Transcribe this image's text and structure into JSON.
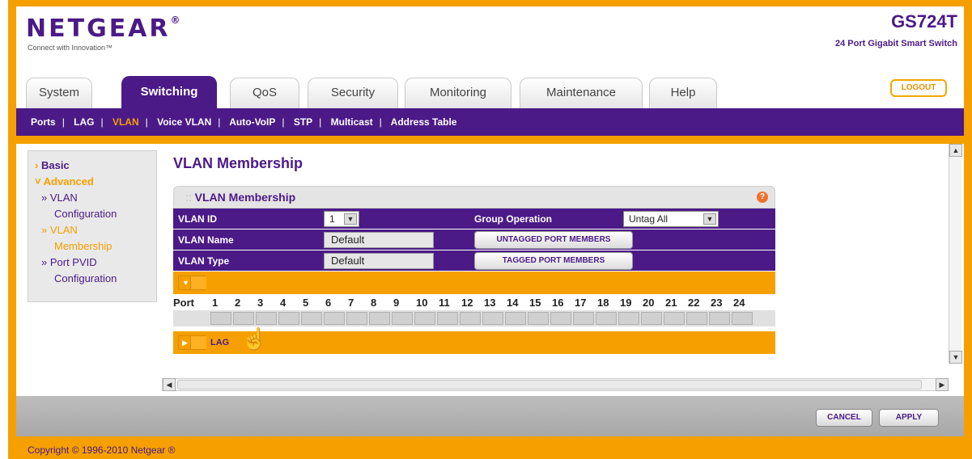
{
  "header": {
    "logo": "NETGEAR",
    "logo_mark": "®",
    "tagline": "Connect with Innovation™",
    "model": "GS724T",
    "model_desc": "24 Port Gigabit Smart Switch",
    "logout": "LOGOUT"
  },
  "tabs": [
    {
      "label": "System"
    },
    {
      "label": "Switching",
      "active": true
    },
    {
      "label": "QoS"
    },
    {
      "label": "Security"
    },
    {
      "label": "Monitoring"
    },
    {
      "label": "Maintenance"
    },
    {
      "label": "Help"
    }
  ],
  "subnav": [
    "Ports",
    "LAG",
    "VLAN",
    "Voice VLAN",
    "Auto-VoIP",
    "STP",
    "Multicast",
    "Address Table"
  ],
  "subnav_active": "VLAN",
  "leftnav": {
    "basic": "Basic",
    "advanced": "Advanced",
    "items": [
      {
        "line1": "» VLAN",
        "line2": "Configuration"
      },
      {
        "line1": "» VLAN",
        "line2": "Membership"
      },
      {
        "line1": "» Port PVID",
        "line2": "Configuration"
      }
    ],
    "prefix_basic": "›",
    "prefix_advanced": "˅"
  },
  "page_title": "VLAN Membership",
  "panel": {
    "title": "VLAN Membership",
    "help": "?",
    "vlan_id_label": "VLAN ID",
    "vlan_id_value": "1",
    "group_op_label": "Group Operation",
    "group_op_value": "Untag All",
    "vlan_name_label": "VLAN Name",
    "vlan_name_value": "Default",
    "untagged_button": "UNTAGGED PORT MEMBERS",
    "vlan_type_label": "VLAN Type",
    "vlan_type_value": "Default",
    "tagged_button": "TAGGED PORT MEMBERS",
    "port_label": "Port",
    "ports": [
      "1",
      "2",
      "3",
      "4",
      "5",
      "6",
      "7",
      "8",
      "9",
      "10",
      "11",
      "12",
      "13",
      "14",
      "15",
      "16",
      "17",
      "18",
      "19",
      "20",
      "21",
      "22",
      "23",
      "24"
    ],
    "lag_label": "LAG"
  },
  "footer": {
    "cancel": "CANCEL",
    "apply": "APPLY",
    "copyright": "Copyright © 1996-2010 Netgear ®"
  }
}
